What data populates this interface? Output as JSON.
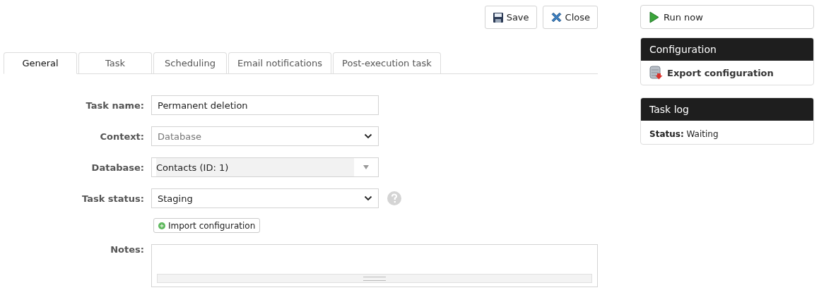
{
  "toolbar": {
    "buttons": [
      {
        "kind": "save",
        "label": "Save"
      },
      {
        "kind": "close",
        "label": "Close"
      }
    ]
  },
  "tabs": [
    {
      "label": "General",
      "selected": true
    },
    {
      "label": "Task",
      "selected": false
    },
    {
      "label": "Scheduling",
      "selected": false
    },
    {
      "label": "Email notifications",
      "selected": false
    },
    {
      "label": "Post-execution task",
      "selected": false
    }
  ],
  "form": {
    "fields": [
      {
        "kind": "text",
        "label": "Task name:",
        "value": "Permanent deletion",
        "disabled": false
      },
      {
        "kind": "select",
        "label": "Context:",
        "value": "Database",
        "disabled": true
      },
      {
        "kind": "combo",
        "label": "Database:",
        "value": "Contacts (ID: 1)",
        "disabled": true
      },
      {
        "kind": "select",
        "label": "Task status:",
        "value": "Staging",
        "disabled": false,
        "help": true
      }
    ],
    "import_button": "Import configuration",
    "notes_label": "Notes:"
  },
  "sidebar": {
    "run_button": "Run now",
    "configuration": {
      "title": "Configuration",
      "action": "Export configuration"
    },
    "task_log": {
      "title": "Task log",
      "status_label": "Status:",
      "status_value": "Waiting"
    }
  }
}
